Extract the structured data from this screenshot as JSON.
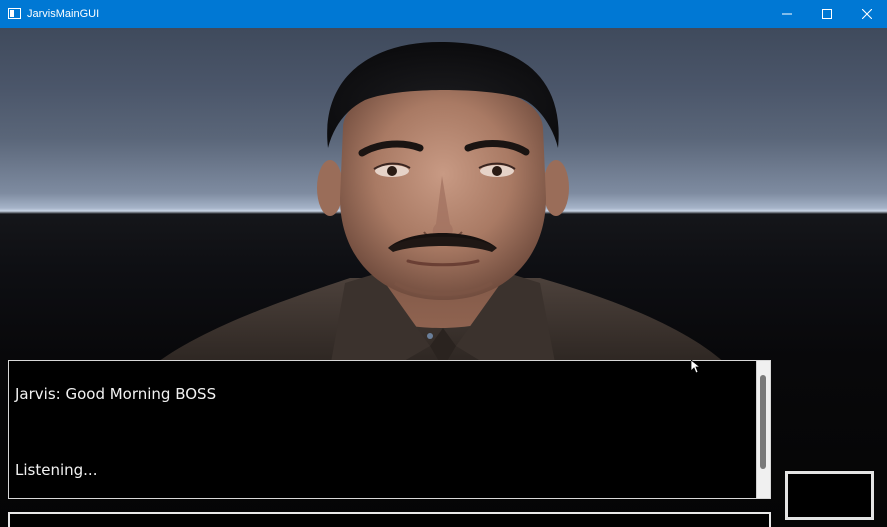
{
  "window": {
    "title": "JarvisMainGUI",
    "accent_color": "#0078d4"
  },
  "titlebar_controls": {
    "minimize_icon": "minimize-icon",
    "maximize_icon": "maximize-icon",
    "close_icon": "close-icon"
  },
  "scene": {
    "avatar_icon": "avatar-3d-face"
  },
  "chat": {
    "line1": "Jarvis: Good Morning BOSS",
    "line2": "Listening..."
  },
  "input": {
    "value": ""
  }
}
